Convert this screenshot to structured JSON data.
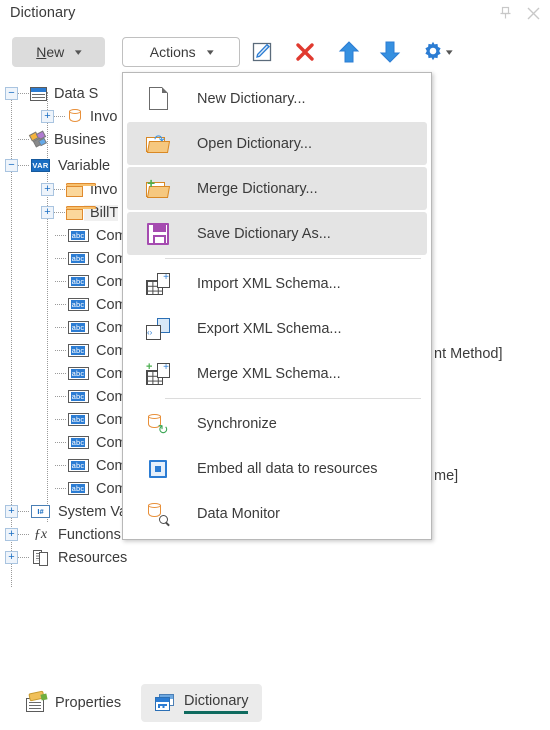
{
  "window": {
    "title": "Dictionary",
    "pin_icon": "pin-icon",
    "close_icon": "close-icon"
  },
  "toolbar": {
    "new_label_prefix": "",
    "new_label_accel": "N",
    "new_label_rest": "ew",
    "new_label": "New",
    "actions_label": "Actions",
    "caret": "⌄",
    "icons": [
      {
        "name": "edit-icon",
        "title": "Edit"
      },
      {
        "name": "delete-icon",
        "title": "Delete"
      },
      {
        "name": "move-up-icon",
        "title": "Move Up"
      },
      {
        "name": "move-down-icon",
        "title": "Move Down"
      },
      {
        "name": "settings-gear-icon",
        "title": "Settings"
      }
    ]
  },
  "tree": {
    "nodes": [
      {
        "id": "data-sources",
        "label": "Data Sources",
        "visible_text": "Data S",
        "icon": "table-icon",
        "indent": 0,
        "expander": "minus",
        "selected": false
      },
      {
        "id": "invoice-ds",
        "label": "Invoice",
        "visible_text": "Invo",
        "icon": "database-icon",
        "indent": 1,
        "expander": "plus",
        "selected": false
      },
      {
        "id": "business-objects",
        "label": "Business Objects",
        "visible_text": "Busines",
        "icon": "business-objects-icon",
        "indent": 0,
        "expander": "none",
        "selected": false
      },
      {
        "id": "variables",
        "label": "Variables",
        "visible_text": "Variable",
        "icon": "variables-icon",
        "indent": 0,
        "expander": "minus",
        "selected": false
      },
      {
        "id": "invoice-var",
        "label": "Invoice",
        "visible_text": "Invo",
        "icon": "folder-icon",
        "indent": 1,
        "expander": "plus",
        "selected": false
      },
      {
        "id": "billto-var",
        "label": "BillTo",
        "visible_text": "BillT",
        "icon": "folder-icon",
        "indent": 1,
        "expander": "plus",
        "selected": true
      },
      {
        "id": "comp-1",
        "label": "Com",
        "visible_text": "Com",
        "icon": "string-variable-icon",
        "indent": 2,
        "expander": "none",
        "selected": false
      },
      {
        "id": "comp-2",
        "label": "Com",
        "visible_text": "Com",
        "icon": "string-variable-icon",
        "indent": 2,
        "expander": "none",
        "selected": false
      },
      {
        "id": "comp-3",
        "label": "Com",
        "visible_text": "Com",
        "icon": "string-variable-icon",
        "indent": 2,
        "expander": "none",
        "selected": false
      },
      {
        "id": "comp-4",
        "label": "Com",
        "visible_text": "Com",
        "icon": "string-variable-icon",
        "indent": 2,
        "expander": "none",
        "selected": false
      },
      {
        "id": "comp-5",
        "label": "Com",
        "visible_text": "Com",
        "icon": "string-variable-icon",
        "indent": 2,
        "expander": "none",
        "selected": false
      },
      {
        "id": "comp-6",
        "label": "Com",
        "visible_text": "Com",
        "icon": "string-variable-icon",
        "indent": 2,
        "expander": "none",
        "selected": false
      },
      {
        "id": "comp-7",
        "label": "Com",
        "visible_text": "Com",
        "icon": "string-variable-icon",
        "indent": 2,
        "expander": "none",
        "selected": false
      },
      {
        "id": "comp-8",
        "label": "Com",
        "visible_text": "Com",
        "icon": "string-variable-icon",
        "indent": 2,
        "expander": "none",
        "selected": false
      },
      {
        "id": "comp-9",
        "label": "Com",
        "visible_text": "Com",
        "icon": "string-variable-icon",
        "indent": 2,
        "expander": "none",
        "selected": false
      },
      {
        "id": "comp-10",
        "label": "Com",
        "visible_text": "Com",
        "icon": "string-variable-icon",
        "indent": 2,
        "expander": "none",
        "selected": false
      },
      {
        "id": "comp-11",
        "label": "Com",
        "visible_text": "Com",
        "icon": "string-variable-icon",
        "indent": 2,
        "expander": "none",
        "selected": false
      },
      {
        "id": "company-address",
        "label": "CompanyAddress [Company Address]",
        "visible_text": "CompanyAddress [Company Address]",
        "icon": "string-variable-icon",
        "indent": 2,
        "expander": "none",
        "selected": false
      },
      {
        "id": "system-variables",
        "label": "System Variables",
        "visible_text": "System Variables",
        "icon": "system-variables-icon",
        "indent": 0,
        "expander": "plus",
        "selected": false
      },
      {
        "id": "functions",
        "label": "Functions",
        "visible_text": "Functions",
        "icon": "fx-icon",
        "indent": 0,
        "expander": "plus",
        "selected": false
      },
      {
        "id": "resources",
        "label": "Resources",
        "visible_text": "Resources",
        "icon": "resources-icon",
        "indent": 0,
        "expander": "plus",
        "selected": false
      }
    ],
    "occluded_fragments": [
      {
        "id": "frag-payment-method",
        "text": "nt Method]"
      },
      {
        "id": "frag-name",
        "text": "me]"
      }
    ]
  },
  "menu": {
    "name": "actions-dropdown-menu",
    "items": [
      {
        "id": "new-dictionary",
        "label": "New Dictionary...",
        "icon": "new-document-icon",
        "highlighted": false,
        "separator_after": false
      },
      {
        "id": "open-dictionary",
        "label": "Open Dictionary...",
        "icon": "open-folder-icon",
        "highlighted": true,
        "separator_after": false
      },
      {
        "id": "merge-dictionary",
        "label": "Merge Dictionary...",
        "icon": "merge-folder-icon",
        "highlighted": true,
        "separator_after": false
      },
      {
        "id": "save-dictionary-as",
        "label": "Save Dictionary As...",
        "icon": "save-disk-icon",
        "highlighted": true,
        "separator_after": true
      },
      {
        "id": "import-xml-schema",
        "label": "Import XML Schema...",
        "icon": "import-xml-icon",
        "highlighted": false,
        "separator_after": false
      },
      {
        "id": "export-xml-schema",
        "label": "Export XML Schema...",
        "icon": "export-xml-icon",
        "highlighted": false,
        "separator_after": false
      },
      {
        "id": "merge-xml-schema",
        "label": "Merge XML Schema...",
        "icon": "merge-xml-icon",
        "highlighted": false,
        "separator_after": true
      },
      {
        "id": "synchronize",
        "label": "Synchronize",
        "icon": "synchronize-icon",
        "highlighted": false,
        "separator_after": false
      },
      {
        "id": "embed-all-data",
        "label": "Embed all data to resources",
        "icon": "chip-icon",
        "highlighted": false,
        "separator_after": false
      },
      {
        "id": "data-monitor",
        "label": "Data Monitor",
        "icon": "data-monitor-icon",
        "highlighted": false,
        "separator_after": false
      }
    ]
  },
  "bottom_tabs": [
    {
      "id": "properties",
      "label": "Properties",
      "icon": "properties-icon",
      "active": false
    },
    {
      "id": "dictionary",
      "label": "Dictionary",
      "icon": "dictionary-icon",
      "active": true
    }
  ],
  "colors": {
    "accent_blue": "#2b7cd3",
    "delete_red": "#e03a2f",
    "folder_orange": "#e08a2e",
    "active_tab_underline": "#0f6b5f",
    "menu_highlight": "#e4e4e4",
    "selection": "#f0f0f0",
    "text": "#3b3b3b"
  }
}
